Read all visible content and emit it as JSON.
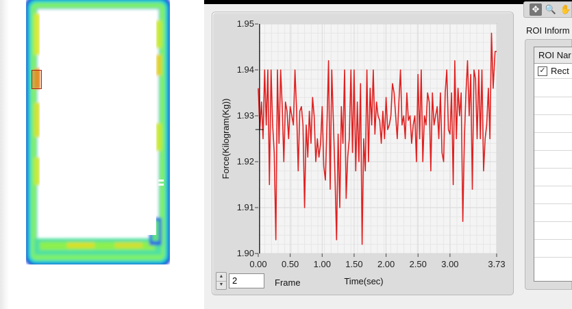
{
  "chart_data": {
    "type": "line",
    "ylabel": "Force(Kilogram(Kg))",
    "xlabel": "Time(sec)",
    "xlim": [
      0.0,
      3.73
    ],
    "ylim": [
      1.9,
      1.95
    ],
    "x_ticks": [
      "0.00",
      "0.50",
      "1.00",
      "1.50",
      "2.00",
      "2.50",
      "3.00",
      "3.73"
    ],
    "y_ticks": [
      "1.95",
      "1.94",
      "1.93",
      "1.92",
      "1.91",
      "1.90"
    ],
    "grid": true,
    "cursor_x": 0.02,
    "series": [
      {
        "color": "#e02020",
        "x": [
          0.0,
          0.025,
          0.05,
          0.075,
          0.1,
          0.125,
          0.15,
          0.175,
          0.2,
          0.225,
          0.25,
          0.275,
          0.3,
          0.325,
          0.35,
          0.375,
          0.4,
          0.425,
          0.45,
          0.475,
          0.5,
          0.525,
          0.55,
          0.575,
          0.6,
          0.625,
          0.65,
          0.675,
          0.7,
          0.725,
          0.75,
          0.775,
          0.8,
          0.825,
          0.85,
          0.875,
          0.9,
          0.925,
          0.95,
          0.975,
          1.0,
          1.025,
          1.05,
          1.075,
          1.1,
          1.125,
          1.15,
          1.175,
          1.2,
          1.225,
          1.25,
          1.275,
          1.3,
          1.325,
          1.35,
          1.375,
          1.4,
          1.425,
          1.45,
          1.475,
          1.5,
          1.525,
          1.55,
          1.575,
          1.6,
          1.625,
          1.65,
          1.675,
          1.7,
          1.725,
          1.75,
          1.775,
          1.8,
          1.825,
          1.85,
          1.875,
          1.9,
          1.925,
          1.95,
          1.975,
          2.0,
          2.025,
          2.05,
          2.075,
          2.1,
          2.125,
          2.15,
          2.175,
          2.2,
          2.225,
          2.25,
          2.275,
          2.3,
          2.325,
          2.35,
          2.375,
          2.4,
          2.425,
          2.45,
          2.475,
          2.5,
          2.525,
          2.55,
          2.575,
          2.6,
          2.625,
          2.65,
          2.675,
          2.7,
          2.725,
          2.75,
          2.775,
          2.8,
          2.825,
          2.85,
          2.875,
          2.9,
          2.925,
          2.95,
          2.975,
          3.0,
          3.025,
          3.05,
          3.075,
          3.1,
          3.125,
          3.15,
          3.175,
          3.2,
          3.225,
          3.25,
          3.275,
          3.3,
          3.325,
          3.35,
          3.375,
          3.4,
          3.425,
          3.45,
          3.475,
          3.5,
          3.525,
          3.55,
          3.575,
          3.6,
          3.625,
          3.65,
          3.675,
          3.705,
          3.73
        ],
        "values": [
          1.936,
          1.927,
          1.933,
          1.925,
          1.94,
          1.928,
          1.94,
          1.915,
          1.94,
          1.928,
          1.922,
          1.903,
          1.94,
          1.924,
          1.94,
          1.932,
          1.92,
          1.933,
          1.931,
          1.925,
          1.932,
          1.93,
          1.928,
          1.94,
          1.931,
          1.918,
          1.931,
          1.932,
          1.928,
          1.91,
          1.928,
          1.921,
          1.931,
          1.924,
          1.934,
          1.93,
          1.92,
          1.925,
          1.921,
          1.924,
          1.932,
          1.919,
          1.916,
          1.928,
          1.942,
          1.914,
          1.94,
          1.929,
          1.917,
          1.903,
          1.926,
          1.91,
          1.932,
          1.924,
          1.94,
          1.912,
          1.921,
          1.925,
          1.94,
          1.922,
          1.94,
          1.918,
          1.933,
          1.92,
          1.937,
          1.902,
          1.925,
          1.918,
          1.94,
          1.92,
          1.936,
          1.928,
          1.94,
          1.926,
          1.933,
          1.93,
          1.929,
          1.924,
          1.931,
          1.925,
          1.934,
          1.927,
          1.928,
          1.93,
          1.937,
          1.935,
          1.93,
          1.925,
          1.933,
          1.94,
          1.928,
          1.93,
          1.925,
          1.935,
          1.929,
          1.93,
          1.924,
          1.928,
          1.93,
          1.92,
          1.939,
          1.925,
          1.94,
          1.92,
          1.93,
          1.928,
          1.935,
          1.933,
          1.918,
          1.935,
          1.928,
          1.93,
          1.932,
          1.925,
          1.935,
          1.922,
          1.92,
          1.935,
          1.94,
          1.927,
          1.926,
          1.935,
          1.915,
          1.942,
          1.925,
          1.936,
          1.93,
          1.935,
          1.907,
          1.925,
          1.935,
          1.942,
          1.93,
          1.939,
          1.914,
          1.94,
          1.938,
          1.925,
          1.94,
          1.925,
          1.94,
          1.918,
          1.925,
          1.928,
          1.936,
          1.925,
          1.948,
          1.936,
          1.944,
          1.944
        ]
      }
    ]
  },
  "frame_control": {
    "value": "2",
    "label": "Frame",
    "up_glyph": "▲",
    "down_glyph": "▼"
  },
  "toolbar": {
    "move_glyph": "✥",
    "zoom_glyph": "🔍",
    "pan_glyph": "✋"
  },
  "roi_panel": {
    "title": "ROI Inform",
    "header": "ROI Nar",
    "rows": [
      {
        "checked": true,
        "check_glyph": "✓",
        "label": "Rect"
      }
    ]
  },
  "colors": {
    "plot_line": "#e02020",
    "plot_bg": "#f4f4f4",
    "grid": "#d9d9d9"
  }
}
